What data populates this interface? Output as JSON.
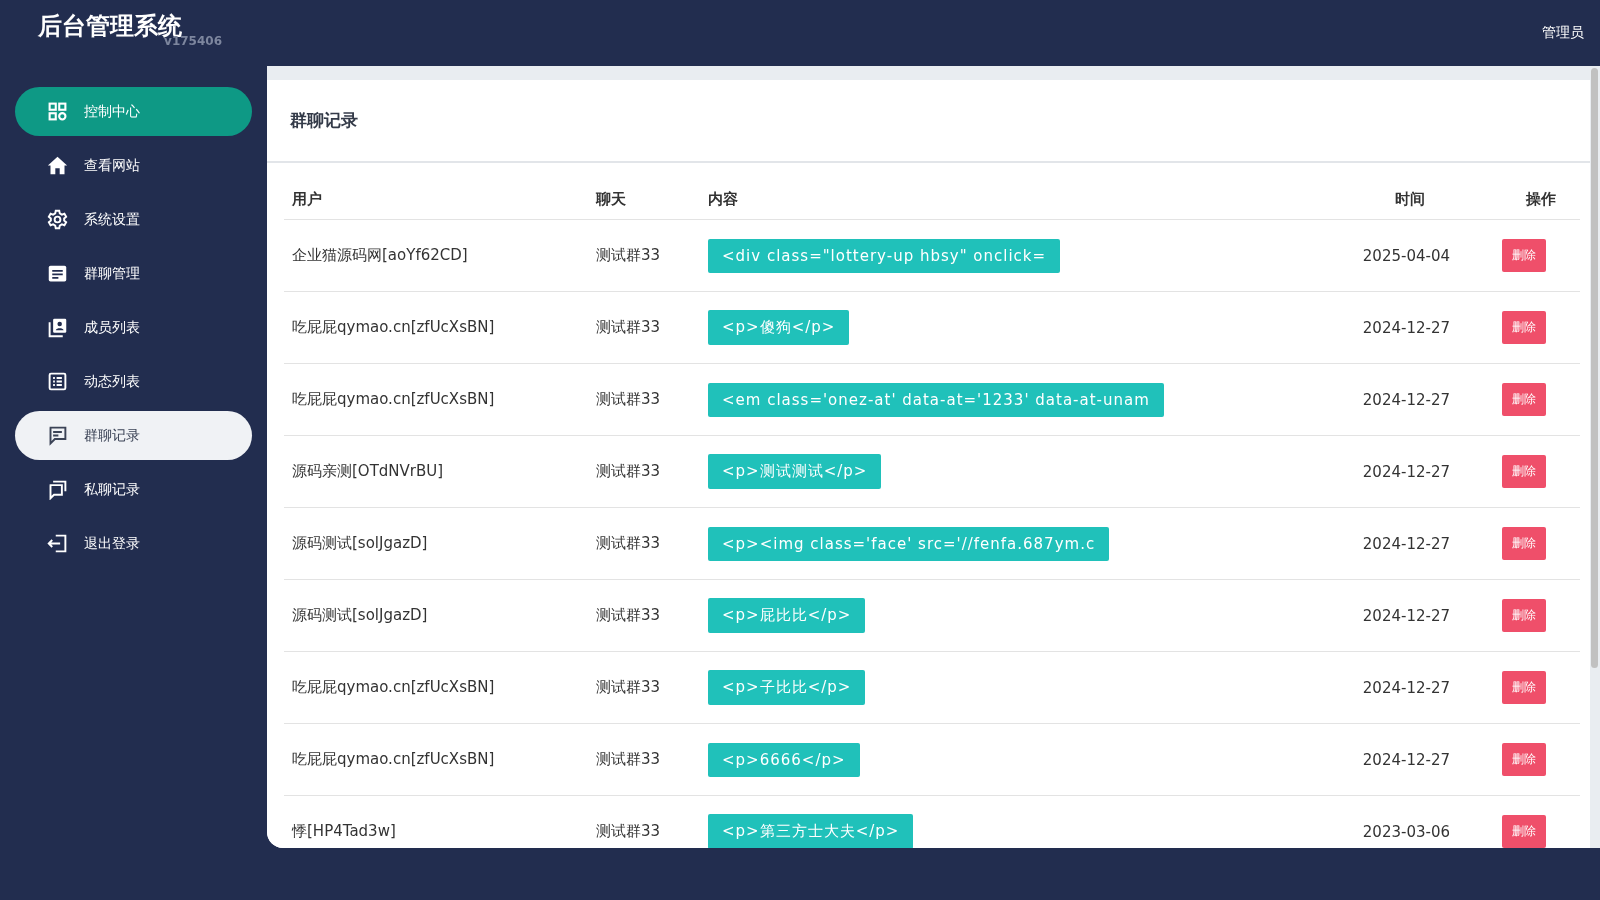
{
  "header": {
    "title": "后台管理系统",
    "version": "v175406",
    "user": "管理员"
  },
  "sidebar": {
    "items": [
      {
        "label": "控制中心",
        "highlighted": true,
        "selected": false
      },
      {
        "label": "查看网站",
        "highlighted": false,
        "selected": false
      },
      {
        "label": "系统设置",
        "highlighted": false,
        "selected": false
      },
      {
        "label": "群聊管理",
        "highlighted": false,
        "selected": false
      },
      {
        "label": "成员列表",
        "highlighted": false,
        "selected": false
      },
      {
        "label": "动态列表",
        "highlighted": false,
        "selected": false
      },
      {
        "label": "群聊记录",
        "highlighted": false,
        "selected": true
      },
      {
        "label": "私聊记录",
        "highlighted": false,
        "selected": false
      },
      {
        "label": "退出登录",
        "highlighted": false,
        "selected": false
      }
    ]
  },
  "page": {
    "title": "群聊记录"
  },
  "table": {
    "columns": [
      "用户",
      "聊天",
      "内容",
      "时间",
      "操作"
    ],
    "rows": [
      {
        "user": "企业猫源码网[aoYf62CD]",
        "chat": "测试群33",
        "content": "<div class=\"lottery-up hbsy\" onclick=",
        "time": "2025-04-04",
        "action": "删除"
      },
      {
        "user": "吃屁屁qymao.cn[zfUcXsBN]",
        "chat": "测试群33",
        "content": "<p>傻狗</p>",
        "time": "2024-12-27",
        "action": "删除"
      },
      {
        "user": "吃屁屁qymao.cn[zfUcXsBN]",
        "chat": "测试群33",
        "content": "<em class='onez-at' data-at='1233' data-at-unam",
        "time": "2024-12-27",
        "action": "删除"
      },
      {
        "user": "源码亲测[OTdNVrBU]",
        "chat": "测试群33",
        "content": "<p>测试测试</p>",
        "time": "2024-12-27",
        "action": "删除"
      },
      {
        "user": "源码测试[solJgazD]",
        "chat": "测试群33",
        "content": "<p><img class='face' src='//fenfa.687ym.c",
        "time": "2024-12-27",
        "action": "删除"
      },
      {
        "user": "源码测试[solJgazD]",
        "chat": "测试群33",
        "content": "<p>屁比比</p>",
        "time": "2024-12-27",
        "action": "删除"
      },
      {
        "user": "吃屁屁qymao.cn[zfUcXsBN]",
        "chat": "测试群33",
        "content": "<p>子比比</p>",
        "time": "2024-12-27",
        "action": "删除"
      },
      {
        "user": "吃屁屁qymao.cn[zfUcXsBN]",
        "chat": "测试群33",
        "content": "<p>6666</p>",
        "time": "2024-12-27",
        "action": "删除"
      },
      {
        "user": "悸[HP4Tad3w]",
        "chat": "测试群33",
        "content": "<p>第三方士大夫</p>",
        "time": "2023-03-06",
        "action": "删除"
      }
    ]
  }
}
